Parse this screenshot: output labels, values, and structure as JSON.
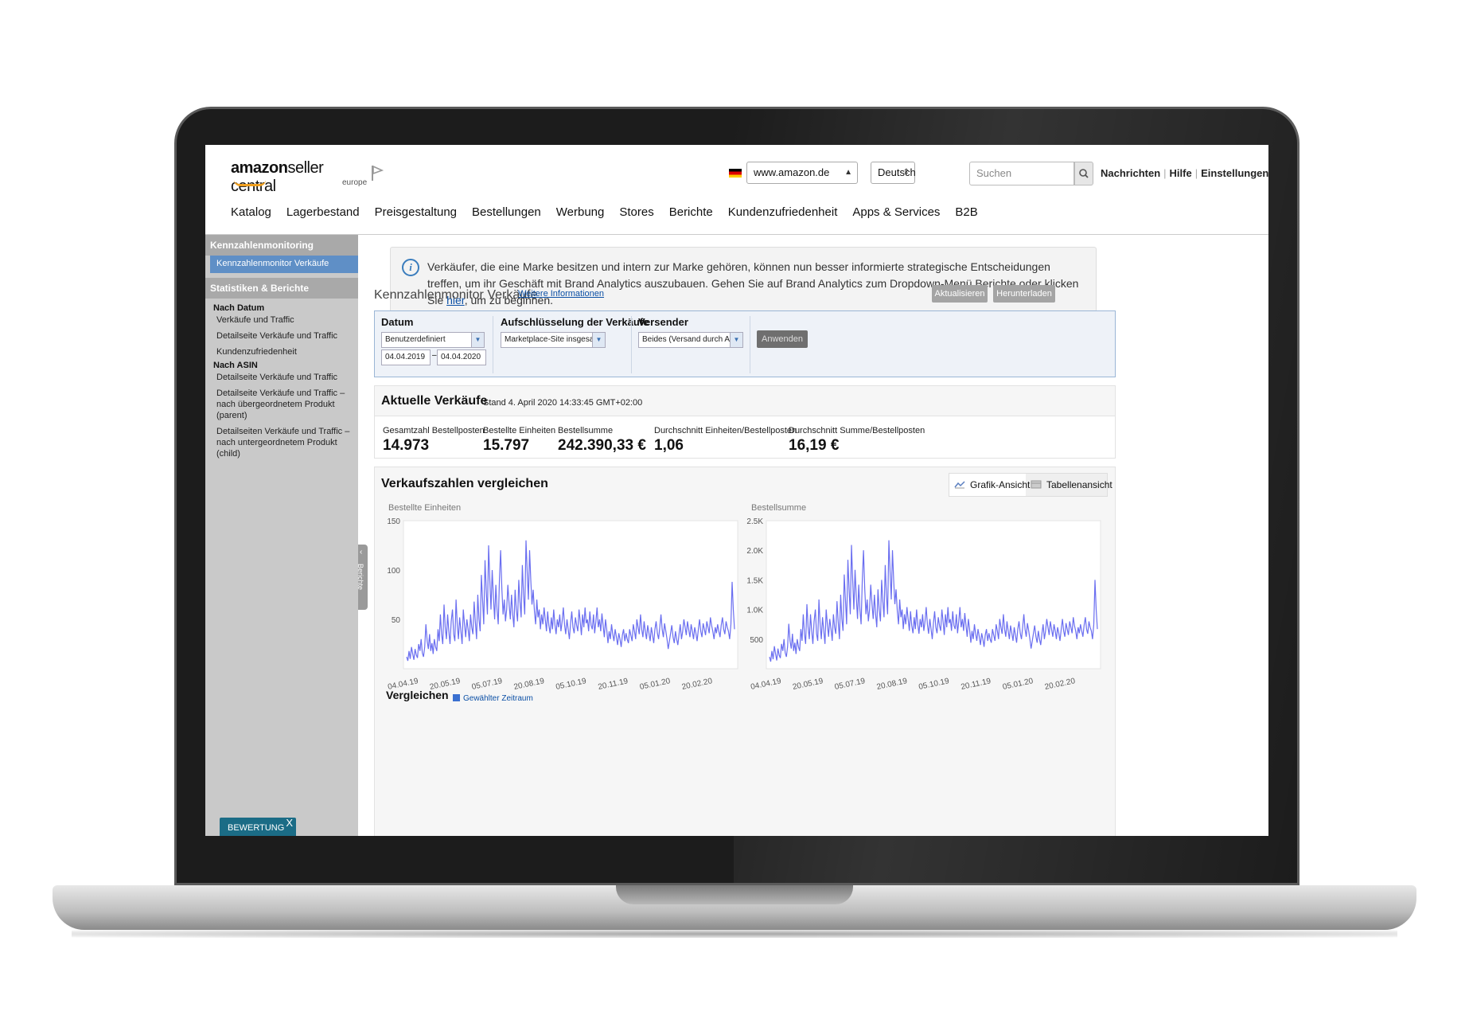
{
  "header": {
    "logo_brand": "amazon",
    "logo_product": "seller central",
    "logo_region": "europe",
    "marketplace": "www.amazon.de",
    "language": "Deutsch",
    "search_placeholder": "Suchen",
    "links": [
      "Nachrichten",
      "Hilfe",
      "Einstellungen"
    ]
  },
  "nav": {
    "items": [
      "Katalog",
      "Lagerbestand",
      "Preisgestaltung",
      "Bestellungen",
      "Werbung",
      "Stores",
      "Berichte",
      "Kundenzufriedenheit",
      "Apps & Services",
      "B2B"
    ]
  },
  "sidebar": {
    "section1": "Kennzahlenmonitoring",
    "active_item": "Kennzahlenmonitor Verkäufe",
    "section2": "Statistiken & Berichte",
    "group_date": "Nach Datum",
    "date_items": [
      "Verkäufe und Traffic",
      "Detailseite Verkäufe und Traffic",
      "Kundenzufriedenheit"
    ],
    "group_asin": "Nach ASIN",
    "asin_items": [
      "Detailseite Verkäufe und Traffic",
      "Detailseite Verkäufe und Traffic – nach übergeordnetem Produkt (parent)",
      "Detailseiten Verkäufe und Traffic – nach untergeordnetem Produkt (child)"
    ],
    "rating_button": "BEWERTUNG",
    "rating_close": "X",
    "collapse_label": "Berichte"
  },
  "info": {
    "text_before": "Verkäufer, die eine Marke besitzen und intern zur Marke gehören, können nun besser informierte strategische Entscheidungen treffen, um ihr Geschäft mit Brand Analytics auszubauen. Gehen Sie auf Brand Analytics zum Dropdown-Menü Berichte oder klicken Sie ",
    "link": "hier",
    "text_after": ", um zu beginnen."
  },
  "monitor": {
    "title": "Kennzahlenmonitor Verkäufe",
    "more_link": "Weitere Informationen",
    "refresh_button": "Aktualisieren",
    "download_button": "Herunterladen"
  },
  "filters": {
    "date_label": "Datum",
    "date_select": "Benutzerdefiniert",
    "date_from": "04.04.2019",
    "date_sep": "–",
    "date_to": "04.04.2020",
    "breakdown_label": "Aufschlüsselung der Verkäufe",
    "breakdown_select": "Marketplace-Site insgesamt",
    "shipper_label": "Versender",
    "shipper_select": "Beides (Versand durch Amazon",
    "apply_button": "Anwenden"
  },
  "current_sales": {
    "title": "Aktuelle Verkäufe",
    "as_of": "Stand 4. April 2020 14:33:45 GMT+02:00",
    "kpis": [
      {
        "label": "Gesamtzahl Bestellposten",
        "value": "14.973"
      },
      {
        "label": "Bestellte Einheiten",
        "value": "15.797"
      },
      {
        "label": "Bestellsumme",
        "value": "242.390,33 €"
      },
      {
        "label": "Durchschnitt Einheiten/Bestellposten",
        "value": "1,06"
      },
      {
        "label": "Durchschnitt Summe/Bestellposten",
        "value": "16,19 €"
      }
    ]
  },
  "compare": {
    "title": "Verkaufszahlen vergleichen",
    "view_chart": "Grafik-Ansicht",
    "view_table": "Tabellenansicht",
    "compare_label": "Vergleichen",
    "compare_option": "Gewählter Zeitraum"
  },
  "colors": {
    "line": "#6a6ef0",
    "accent_blue": "#5f8fc6",
    "sidebar_bg": "#c9c9c9",
    "rating_button": "#1b6c86"
  },
  "chart_data": [
    {
      "type": "line",
      "title": "Bestellte Einheiten",
      "x_ticks": [
        "04.04.19",
        "20.05.19",
        "05.07.19",
        "20.08.19",
        "05.10.19",
        "20.11.19",
        "05.01.20",
        "20.02.20"
      ],
      "y_ticks": [
        "150",
        "100",
        "50"
      ],
      "ylim": [
        0,
        150
      ],
      "x_start": "2019-04-04",
      "x_end": "2020-04-04",
      "series": [
        {
          "values": [
            12,
            8,
            18,
            10,
            22,
            15,
            9,
            20,
            14,
            11,
            25,
            18,
            30,
            16,
            12,
            22,
            45,
            28,
            20,
            35,
            18,
            26,
            15,
            30,
            22,
            18,
            40,
            28,
            55,
            35,
            25,
            65,
            42,
            30,
            55,
            38,
            25,
            48,
            60,
            35,
            28,
            70,
            45,
            30,
            52,
            38,
            25,
            60,
            45,
            32,
            50,
            40,
            28,
            55,
            42,
            35,
            68,
            48,
            30,
            75,
            50,
            38,
            95,
            70,
            45,
            110,
            80,
            55,
            125,
            90,
            60,
            100,
            72,
            50,
            85,
            60,
            45,
            90,
            120,
            80,
            55,
            70,
            48,
            60,
            85,
            65,
            50,
            75,
            55,
            42,
            80,
            60,
            48,
            90,
            68,
            52,
            105,
            75,
            55,
            130,
            98,
            70,
            120,
            90,
            65,
            80,
            58,
            45,
            70,
            52,
            60,
            40,
            55,
            45,
            62,
            50,
            38,
            58,
            44,
            36,
            52,
            40,
            60,
            45,
            35,
            50,
            42,
            55,
            38,
            48,
            62,
            45,
            35,
            50,
            40,
            30,
            46,
            58,
            42,
            36,
            52,
            44,
            38,
            60,
            48,
            34,
            55,
            42,
            62,
            46,
            50,
            38,
            58,
            44,
            40,
            55,
            36,
            48,
            62,
            42,
            50,
            38,
            56,
            44,
            32,
            50,
            40,
            26,
            38,
            30,
            45,
            35,
            28,
            40,
            32,
            24,
            36,
            30,
            22,
            34,
            40,
            28,
            36,
            30,
            26,
            40,
            34,
            28,
            45,
            38,
            30,
            50,
            42,
            35,
            55,
            40,
            32,
            48,
            38,
            30,
            44,
            36,
            28,
            42,
            34,
            26,
            40,
            48,
            36,
            30,
            42,
            55,
            40,
            32,
            46,
            38,
            30,
            20,
            28,
            36,
            44,
            32,
            26,
            38,
            30,
            24,
            35,
            45,
            30,
            38,
            50,
            42,
            34,
            48,
            40,
            32,
            45,
            38,
            30,
            42,
            36,
            28,
            40,
            50,
            38,
            32,
            46,
            40,
            34,
            48,
            42,
            36,
            52,
            44,
            38,
            30,
            42,
            36,
            45,
            38,
            32,
            44,
            52,
            40,
            35,
            48,
            42,
            38,
            30,
            45,
            88,
            60,
            40
          ]
        }
      ]
    },
    {
      "type": "line",
      "title": "Bestellsumme",
      "x_ticks": [
        "04.04.19",
        "20.05.19",
        "05.07.19",
        "20.08.19",
        "05.10.19",
        "20.11.19",
        "05.01.20",
        "20.02.20"
      ],
      "y_ticks": [
        "2.5K",
        "2.0K",
        "1.5K",
        "1.0K",
        "500"
      ],
      "ylim": [
        0,
        2500
      ],
      "x_start": "2019-04-04",
      "x_end": "2020-04-04",
      "series": [
        {
          "values": [
            200,
            120,
            300,
            160,
            380,
            250,
            140,
            340,
            230,
            180,
            420,
            300,
            500,
            270,
            200,
            370,
            760,
            470,
            340,
            590,
            300,
            440,
            250,
            500,
            370,
            300,
            670,
            470,
            920,
            590,
            420,
            1090,
            700,
            500,
            920,
            640,
            420,
            800,
            1000,
            590,
            470,
            1170,
            750,
            500,
            870,
            640,
            420,
            1000,
            750,
            540,
            840,
            670,
            470,
            920,
            700,
            590,
            1140,
            800,
            500,
            1250,
            840,
            640,
            1590,
            1170,
            750,
            1840,
            1340,
            920,
            2090,
            1500,
            1000,
            1670,
            1200,
            840,
            1420,
            1000,
            750,
            1500,
            2000,
            1340,
            920,
            1170,
            800,
            1000,
            1420,
            1090,
            840,
            1250,
            920,
            700,
            1340,
            1000,
            800,
            1500,
            1140,
            870,
            1750,
            1250,
            920,
            2170,
            1640,
            1170,
            2000,
            1500,
            1090,
            1340,
            970,
            750,
            1170,
            870,
            1000,
            670,
            920,
            750,
            1040,
            840,
            640,
            970,
            730,
            600,
            870,
            670,
            1000,
            750,
            590,
            840,
            700,
            920,
            640,
            800,
            1040,
            750,
            590,
            840,
            670,
            500,
            770,
            970,
            700,
            600,
            870,
            730,
            640,
            1000,
            800,
            570,
            920,
            700,
            1040,
            770,
            840,
            640,
            970,
            730,
            670,
            920,
            600,
            800,
            1040,
            700,
            840,
            640,
            940,
            730,
            540,
            840,
            670,
            440,
            640,
            500,
            750,
            590,
            470,
            670,
            540,
            400,
            600,
            500,
            370,
            570,
            670,
            470,
            600,
            500,
            440,
            670,
            570,
            470,
            750,
            640,
            500,
            840,
            700,
            590,
            920,
            670,
            540,
            800,
            640,
            500,
            730,
            600,
            470,
            700,
            570,
            440,
            670,
            800,
            600,
            500,
            700,
            920,
            670,
            540,
            770,
            640,
            500,
            340,
            470,
            600,
            730,
            540,
            440,
            640,
            500,
            400,
            590,
            750,
            500,
            640,
            840,
            700,
            570,
            800,
            670,
            540,
            750,
            640,
            500,
            700,
            600,
            470,
            670,
            840,
            640,
            540,
            770,
            670,
            570,
            800,
            700,
            600,
            870,
            730,
            640,
            500,
            700,
            600,
            750,
            640,
            540,
            730,
            870,
            670,
            590,
            800,
            700,
            640,
            500,
            750,
            1500,
            1000,
            670
          ]
        }
      ]
    }
  ]
}
